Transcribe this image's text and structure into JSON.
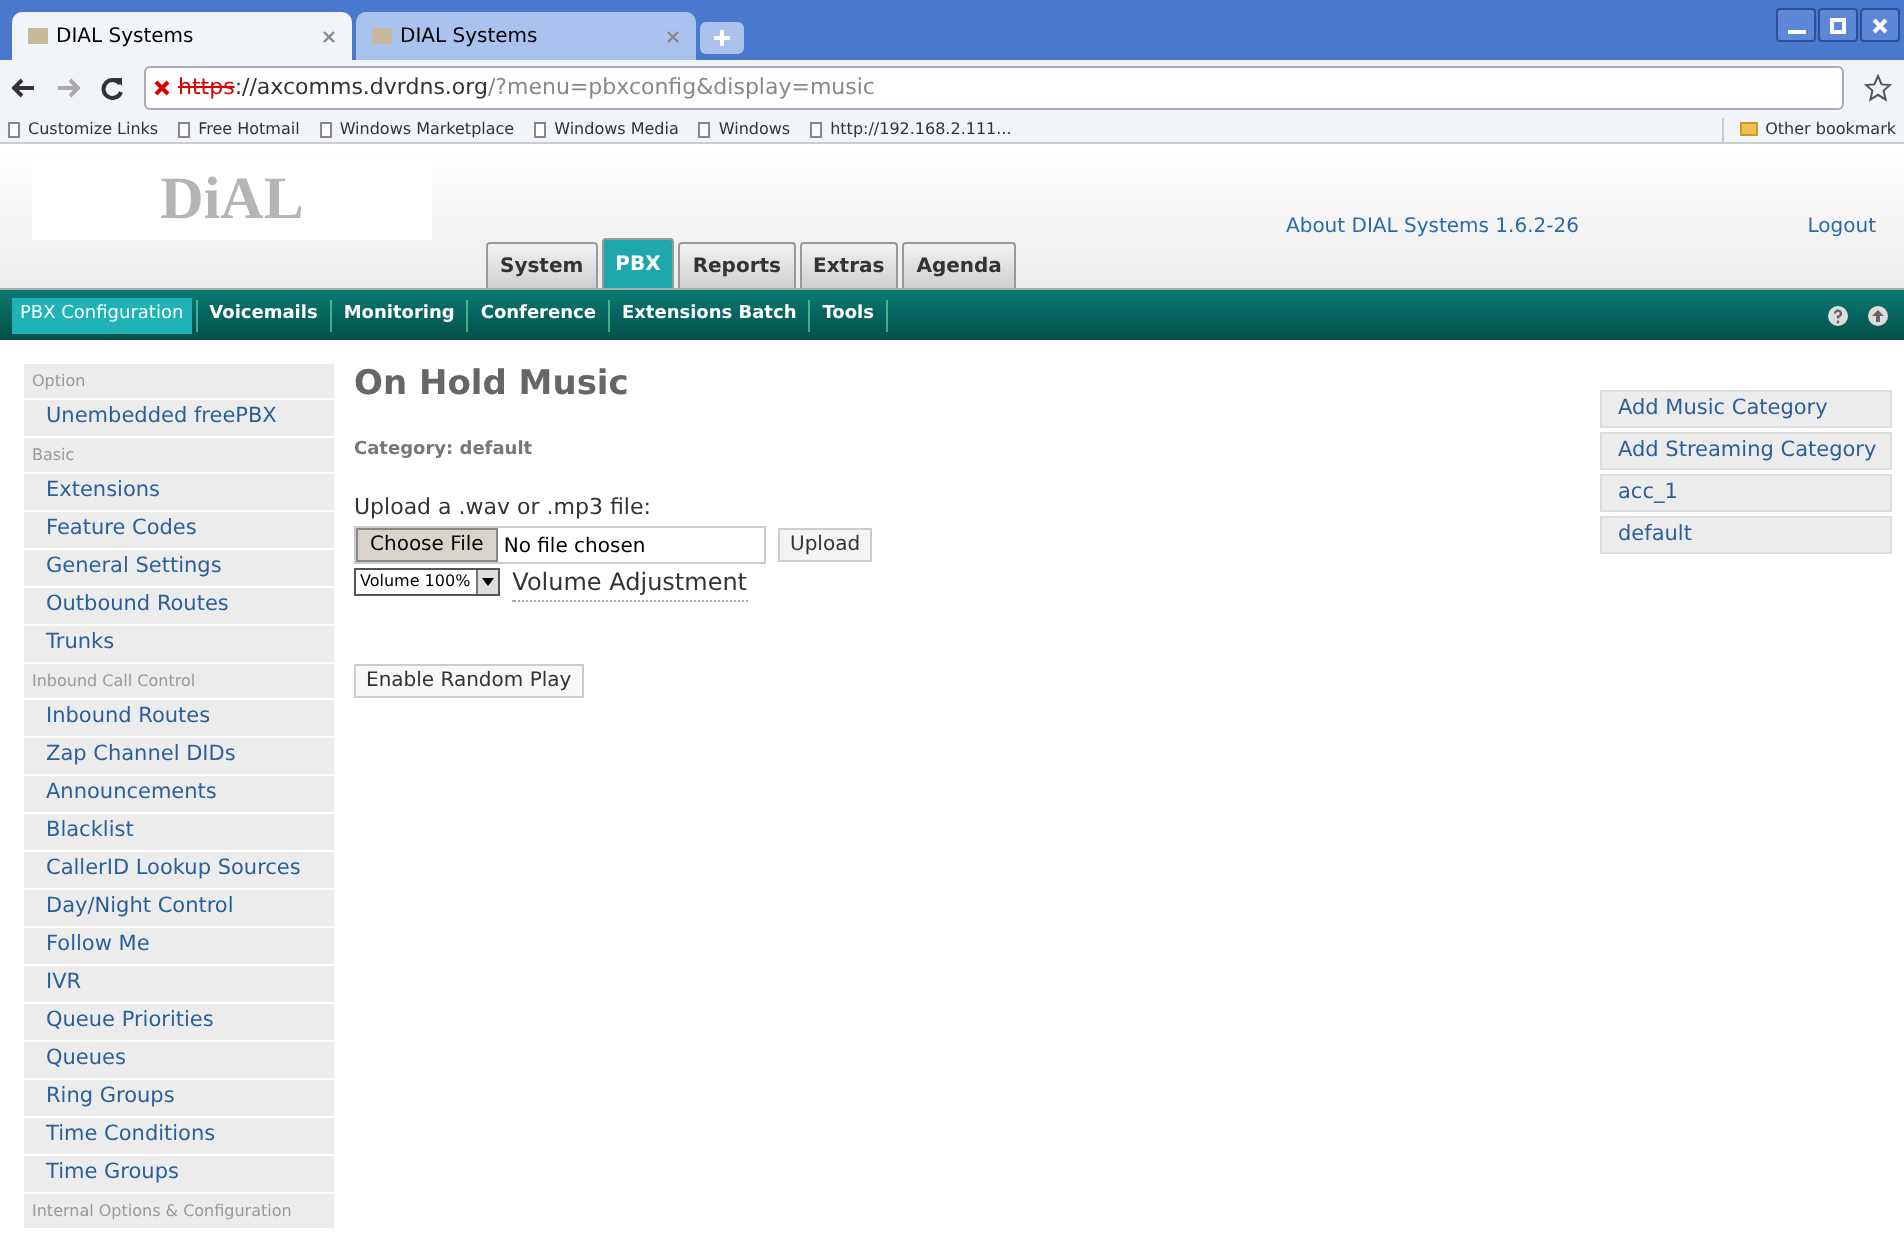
{
  "browser": {
    "tabs": [
      {
        "title": "DIAL Systems",
        "selected": true
      },
      {
        "title": "DIAL Systems",
        "selected": false
      }
    ],
    "url": {
      "struck": "https",
      "host": "://axcomms.dvrdns.org",
      "path": "/?menu=pbxconfig&display=music"
    },
    "bookmarks": [
      "Customize Links",
      "Free Hotmail",
      "Windows Marketplace",
      "Windows Media",
      "Windows",
      "http://192.168.2.111..."
    ],
    "other_bookmarks": "Other bookmark"
  },
  "header": {
    "logo": "DiAL",
    "about": "About DIAL Systems 1.6.2-26",
    "logout": "Logout",
    "tabs": [
      {
        "label": "System",
        "selected": false
      },
      {
        "label": "PBX",
        "selected": true
      },
      {
        "label": "Reports",
        "selected": false
      },
      {
        "label": "Extras",
        "selected": false
      },
      {
        "label": "Agenda",
        "selected": false
      }
    ]
  },
  "nav": [
    {
      "label": "PBX Configuration",
      "selected": true
    },
    {
      "label": "Voicemails",
      "selected": false
    },
    {
      "label": "Monitoring",
      "selected": false
    },
    {
      "label": "Conference",
      "selected": false
    },
    {
      "label": "Extensions Batch",
      "selected": false
    },
    {
      "label": "Tools",
      "selected": false
    }
  ],
  "sidebar": {
    "items": [
      {
        "kind": "header",
        "label": "Option"
      },
      {
        "kind": "link",
        "label": "Unembedded freePBX"
      },
      {
        "kind": "header",
        "label": "Basic"
      },
      {
        "kind": "link",
        "label": "Extensions"
      },
      {
        "kind": "link",
        "label": "Feature Codes"
      },
      {
        "kind": "link",
        "label": "General Settings"
      },
      {
        "kind": "link",
        "label": "Outbound Routes"
      },
      {
        "kind": "link",
        "label": "Trunks"
      },
      {
        "kind": "header",
        "label": "Inbound Call Control"
      },
      {
        "kind": "link",
        "label": "Inbound Routes"
      },
      {
        "kind": "link",
        "label": "Zap Channel DIDs"
      },
      {
        "kind": "link",
        "label": "Announcements"
      },
      {
        "kind": "link",
        "label": "Blacklist"
      },
      {
        "kind": "link",
        "label": "CallerID Lookup Sources"
      },
      {
        "kind": "link",
        "label": "Day/Night Control"
      },
      {
        "kind": "link",
        "label": "Follow Me"
      },
      {
        "kind": "link",
        "label": "IVR"
      },
      {
        "kind": "link",
        "label": "Queue Priorities"
      },
      {
        "kind": "link",
        "label": "Queues"
      },
      {
        "kind": "link",
        "label": "Ring Groups"
      },
      {
        "kind": "link",
        "label": "Time Conditions"
      },
      {
        "kind": "link",
        "label": "Time Groups"
      },
      {
        "kind": "header",
        "label": "Internal Options & Configuration"
      }
    ]
  },
  "main": {
    "title": "On Hold Music",
    "category": "Category: default",
    "upload_label": "Upload a .wav or .mp3 file:",
    "choose_file": "Choose File",
    "file_status": "No file chosen",
    "upload": "Upload",
    "volume": "Volume 100%",
    "volume_label": "Volume Adjustment",
    "random_play": "Enable Random Play"
  },
  "categories": [
    "Add Music Category",
    "Add Streaming Category",
    "acc_1",
    "default"
  ]
}
